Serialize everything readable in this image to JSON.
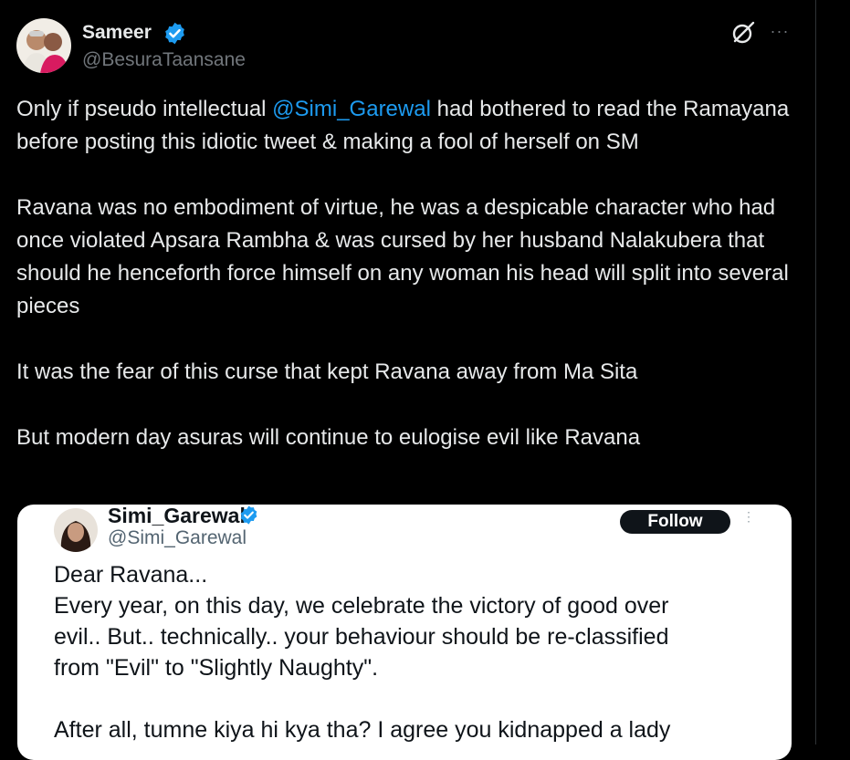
{
  "tweet": {
    "author": {
      "name": "Sameer",
      "handle": "@BesuraTaansane"
    },
    "icons": {
      "verified": "verified-badge-icon",
      "grok": "grok-icon",
      "more": "more-options-icon"
    },
    "colors": {
      "background": "#000000",
      "text": "#e7e9ea",
      "muted": "#71767b",
      "link": "#1d9bf0",
      "verified": "#1d9bf0"
    },
    "text": {
      "p1_before": "Only if pseudo intellectual ",
      "p1_mention": "@Simi_Garewal",
      "p1_after": " had bothered to read the Ramayana before posting this idiotic tweet & making a fool of herself on SM",
      "p2": "Ravana was no embodiment of virtue, he was a despicable character who had once violated Apsara Rambha & was cursed by her husband Nalakubera that should he henceforth force himself on any woman his head will split into several pieces",
      "p3": "It was the fear of this curse that kept Ravana away from Ma Sita",
      "p4": "But modern day asuras will continue to eulogise evil like Ravana"
    }
  },
  "embedded_screenshot": {
    "name": "Simi_Garewal",
    "handle": "@Simi_Garewal",
    "follow_label": "Follow",
    "more_icon": "vertical-dots-icon",
    "lines": [
      "Dear Ravana...",
      "Every year, on this day, we celebrate the victory of good over",
      "evil.. But.. technically.. your behaviour should be re-classified",
      "from \"Evil\" to \"Slightly Naughty\"."
    ],
    "line_after_gap": "After all, tumne kiya hi kya tha? I agree you kidnapped a lady"
  }
}
